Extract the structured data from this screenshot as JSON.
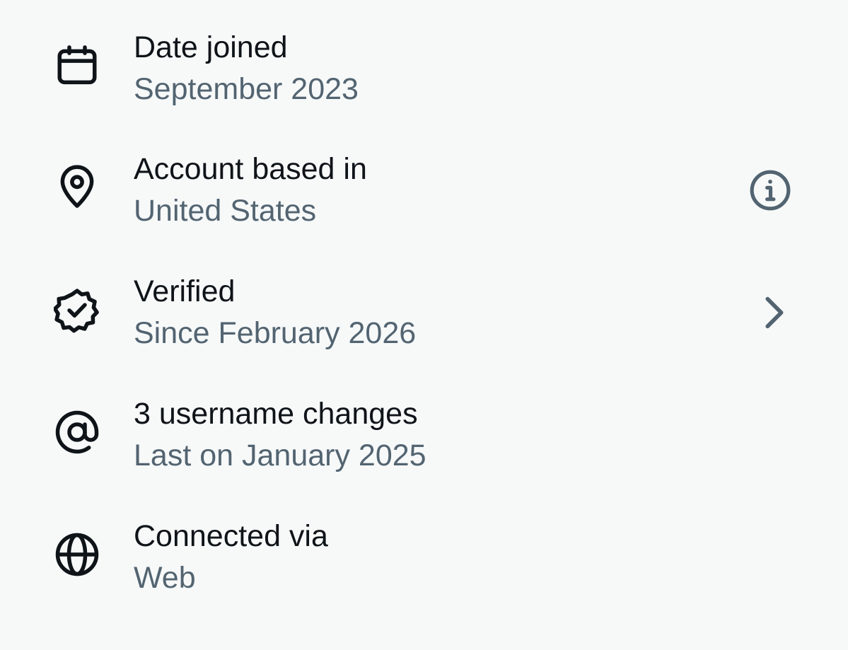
{
  "rows": [
    {
      "icon": "calendar-icon",
      "title": "Date joined",
      "subtitle": "September 2023"
    },
    {
      "icon": "location-pin-icon",
      "title": "Account based in",
      "subtitle": "United States",
      "trailing_icon": "info-icon"
    },
    {
      "icon": "verified-badge-icon",
      "title": "Verified",
      "subtitle": "Since February 2026",
      "trailing_icon": "chevron-right-icon"
    },
    {
      "icon": "at-sign-icon",
      "title": "3 username changes",
      "subtitle": "Last on January 2025"
    },
    {
      "icon": "globe-icon",
      "title": "Connected via",
      "subtitle": "Web"
    }
  ],
  "colors": {
    "background": "#f7f9f9",
    "title_text": "#0f1419",
    "subtitle_text": "#536471",
    "trailing_icon": "#536471"
  }
}
